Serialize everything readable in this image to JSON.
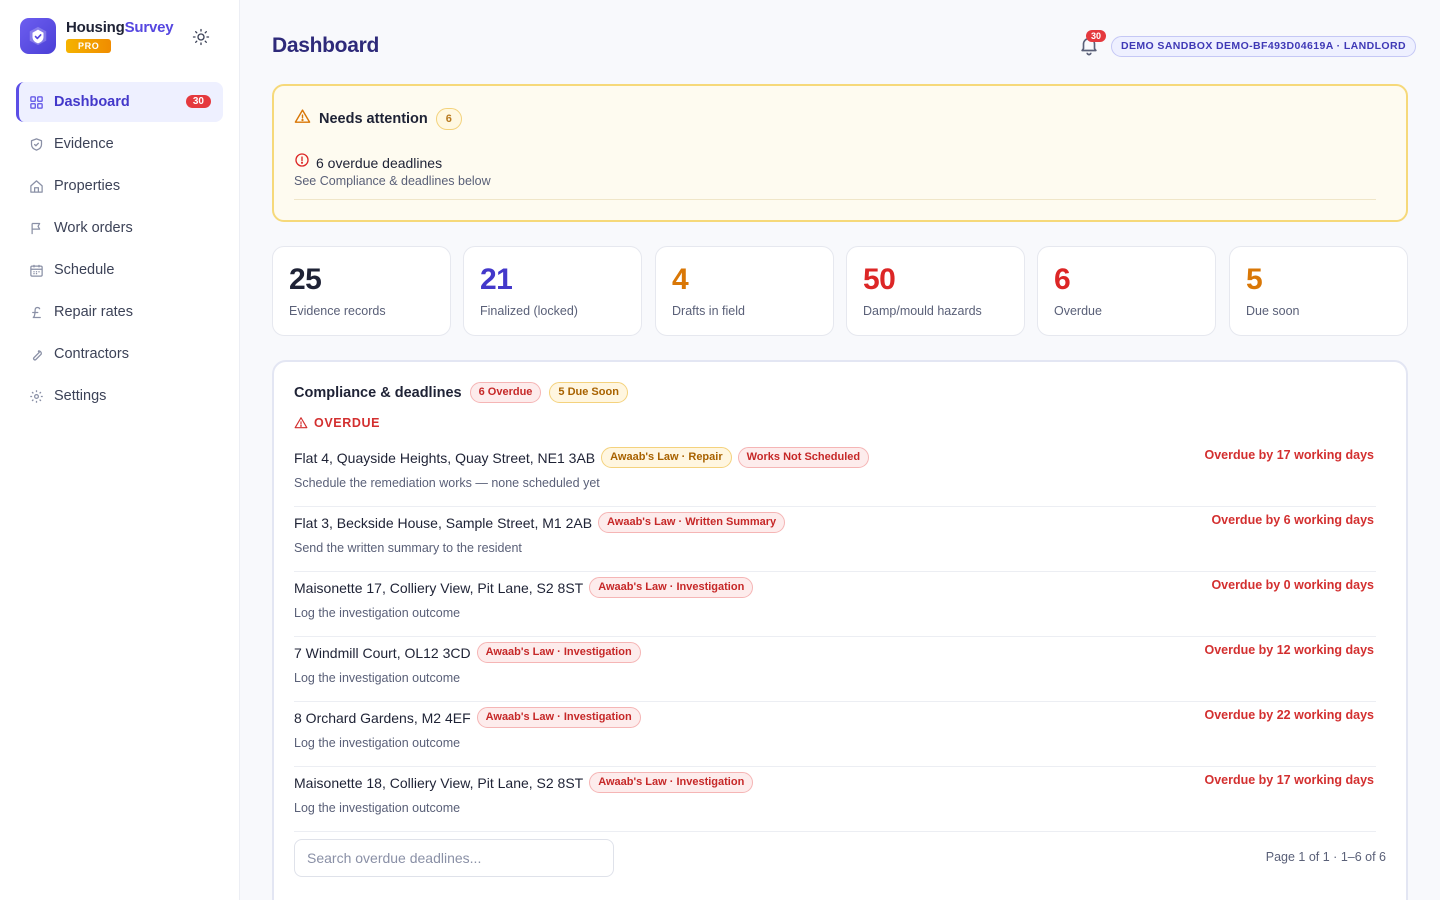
{
  "app": {
    "name_main": "Housing",
    "name_accent": "Survey",
    "tier": "PRO"
  },
  "sidebar": {
    "items": [
      {
        "label": "Dashboard",
        "icon": "grid-icon",
        "badge": "30",
        "active": true
      },
      {
        "label": "Evidence",
        "icon": "shield-icon"
      },
      {
        "label": "Properties",
        "icon": "home-icon"
      },
      {
        "label": "Work orders",
        "icon": "flag-icon"
      },
      {
        "label": "Schedule",
        "icon": "calendar-icon"
      },
      {
        "label": "Repair rates",
        "icon": "pound-icon"
      },
      {
        "label": "Contractors",
        "icon": "wrench-icon"
      },
      {
        "label": "Settings",
        "icon": "gear-icon"
      }
    ]
  },
  "header": {
    "title": "Dashboard",
    "notifications": "30",
    "sandbox": "DEMO SANDBOX DEMO-BF493D04619A · LANDLORD"
  },
  "attention": {
    "title": "Needs attention",
    "count": "6",
    "item_title": "6 overdue deadlines",
    "item_sub": "See Compliance & deadlines below"
  },
  "stats": [
    {
      "value": "25",
      "label": "Evidence records",
      "color": "#1e2235"
    },
    {
      "value": "21",
      "label": "Finalized (locked)",
      "color": "#4338ca"
    },
    {
      "value": "4",
      "label": "Drafts in field",
      "color": "#d97706"
    },
    {
      "value": "50",
      "label": "Damp/mould hazards",
      "color": "#dc2626"
    },
    {
      "value": "6",
      "label": "Overdue",
      "color": "#dc2626"
    },
    {
      "value": "5",
      "label": "Due soon",
      "color": "#d97706"
    }
  ],
  "compliance": {
    "title": "Compliance & deadlines",
    "overdue_pill": "6 Overdue",
    "due_soon_pill": "5 Due Soon",
    "section_label": "OVERDUE",
    "rows": [
      {
        "address": "Flat 4, Quayside Heights, Quay Street, NE1 3AB",
        "tags": [
          {
            "text": "Awaab's Law · Repair",
            "tone": "amber"
          },
          {
            "text": "Works Not Scheduled",
            "tone": "red"
          }
        ],
        "sub": "Schedule the remediation works — none scheduled yet",
        "due": "Overdue by 17 working days"
      },
      {
        "address": "Flat 3, Beckside House, Sample Street, M1 2AB",
        "tags": [
          {
            "text": "Awaab's Law · Written Summary",
            "tone": "red"
          }
        ],
        "sub": "Send the written summary to the resident",
        "due": "Overdue by 6 working days"
      },
      {
        "address": "Maisonette 17, Colliery View, Pit Lane, S2 8ST",
        "tags": [
          {
            "text": "Awaab's Law · Investigation",
            "tone": "red"
          }
        ],
        "sub": "Log the investigation outcome",
        "due": "Overdue by 0 working days"
      },
      {
        "address": "7 Windmill Court, OL12 3CD",
        "tags": [
          {
            "text": "Awaab's Law · Investigation",
            "tone": "red"
          }
        ],
        "sub": "Log the investigation outcome",
        "due": "Overdue by 12 working days"
      },
      {
        "address": "8 Orchard Gardens, M2 4EF",
        "tags": [
          {
            "text": "Awaab's Law · Investigation",
            "tone": "red"
          }
        ],
        "sub": "Log the investigation outcome",
        "due": "Overdue by 22 working days"
      },
      {
        "address": "Maisonette 18, Colliery View, Pit Lane, S2 8ST",
        "tags": [
          {
            "text": "Awaab's Law · Investigation",
            "tone": "red"
          }
        ],
        "sub": "Log the investigation outcome",
        "due": "Overdue by 17 working days"
      }
    ],
    "search_placeholder": "Search overdue deadlines...",
    "pager": "Page 1 of 1 · 1–6 of 6"
  }
}
